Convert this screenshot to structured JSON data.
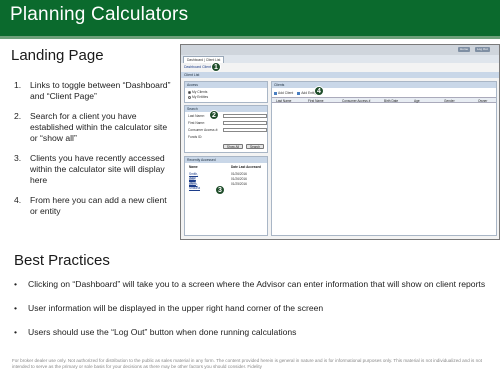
{
  "header": {
    "title": "Planning Calculators"
  },
  "landing": {
    "heading": "Landing Page",
    "steps": [
      {
        "num": "1.",
        "text": "Links to toggle between “Dashboard” and “Client Page”"
      },
      {
        "num": "2.",
        "text": "Search for a client you have established within the calculator site or “show all”"
      },
      {
        "num": "3.",
        "text": "Clients you have recently accessed within the calculator site will display here"
      },
      {
        "num": "4.",
        "text": "From here you can add a new client or entity"
      }
    ]
  },
  "best_practices": {
    "heading": "Best Practices",
    "bullets": [
      "Clicking on “Dashboard” will take you to a screen where the Advisor can enter information that will show on client reports",
      "User information will be displayed in the upper right hand corner of the screen",
      "Users should use the “Log Out” button when done running calculations"
    ]
  },
  "footer": {
    "disclaimer": "For broker dealer use only. Not authorized for distribution to the public as sales material in any form. The content provided herein is general in nature and is for informational purposes only. This material is not individualized and is not intended to serve as the primary or sole basis for your decisions as there may be other factors you should consider. Fidelity"
  },
  "screenshot": {
    "top_buttons": [
      "Home",
      "Log Out"
    ],
    "tab_label": "Dashboard | Client List",
    "crumb": "Dashboard Clients",
    "band_label": "Client List",
    "access_panel": {
      "title": "Access",
      "options": [
        "My Clients",
        "My Entities"
      ]
    },
    "search_panel": {
      "title": "Search",
      "fields": [
        "Last Name:",
        "First Name:",
        "Consumer Access #:",
        "Funds ID:"
      ],
      "buttons": [
        "Show All",
        "Search"
      ]
    },
    "recent_panel": {
      "title": "Recently Accessed",
      "columns": [
        "Name",
        "Date Last Accessed"
      ],
      "rows": [
        {
          "name": "Smith, John",
          "date": "01/26/2016"
        },
        {
          "name": "Doe, Jane",
          "date": "01/26/2016"
        },
        {
          "name": "Dunn, Shauna",
          "date": "01/25/2016"
        }
      ]
    },
    "clients_panel": {
      "title": "Clients",
      "toolbar": [
        "Add Client",
        "Add Entity"
      ],
      "columns": [
        "Last Name",
        "First Name",
        "Consumer Access #",
        "Birth Date",
        "Age",
        "Gender",
        "Owner"
      ]
    },
    "badges": [
      "1",
      "2",
      "3",
      "4"
    ]
  },
  "colors": {
    "title_bar": "#0b6a2d",
    "badge": "#1f4d2a",
    "link": "#1c3d8a"
  }
}
